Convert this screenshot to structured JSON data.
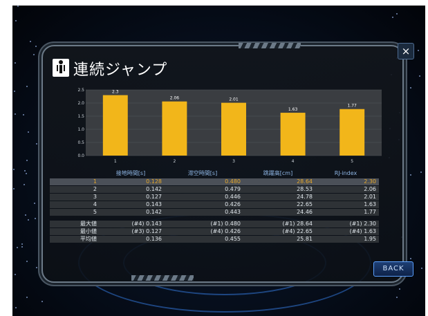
{
  "title": "連続ジャンプ",
  "close_label": "×",
  "back_label": "BACK",
  "chart_data": {
    "type": "bar",
    "categories": [
      "1",
      "2",
      "3",
      "4",
      "5"
    ],
    "values": [
      2.3,
      2.06,
      2.01,
      1.63,
      1.77
    ],
    "value_labels": [
      "2.3",
      "2.06",
      "2.01",
      "1.63",
      "1.77"
    ],
    "ylim": [
      0,
      2.5
    ],
    "yticks": [
      "0.0",
      "0.5",
      "1.0",
      "1.5",
      "2.0",
      "2.5"
    ],
    "bar_color": "#f2b61a",
    "background_color": "#3a3d41"
  },
  "table": {
    "headers": [
      "",
      "接地時間[s]",
      "滞空時間[s]",
      "跳躍高[cm]",
      "RJ-index"
    ],
    "rows": [
      [
        "1",
        "0.128",
        "0.480",
        "28.64",
        "2.30"
      ],
      [
        "2",
        "0.142",
        "0.479",
        "28.53",
        "2.06"
      ],
      [
        "3",
        "0.127",
        "0.446",
        "24.78",
        "2.01"
      ],
      [
        "4",
        "0.143",
        "0.426",
        "22.65",
        "1.63"
      ],
      [
        "5",
        "0.142",
        "0.443",
        "24.46",
        "1.77"
      ]
    ],
    "selected_row": 0,
    "stats": [
      [
        "最大値",
        "(#4) 0.143",
        "(#1) 0.480",
        "(#1)  28.64",
        "(#1) 2.30"
      ],
      [
        "最小値",
        "(#3) 0.127",
        "(#4) 0.426",
        "(#4)  22.65",
        "(#4) 1.63"
      ],
      [
        "平均値",
        "0.136",
        "0.455",
        "25.81",
        "1.95"
      ]
    ]
  },
  "colors": {
    "accent": "#f2b61a",
    "header_text": "#8fb7e6",
    "row_bg": "#2e3236",
    "selected_row_bg": "#4b5058"
  }
}
